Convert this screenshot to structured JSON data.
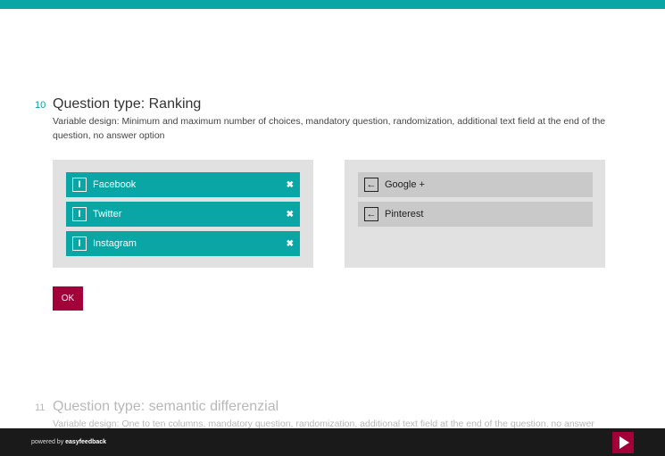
{
  "q10": {
    "number": "10",
    "title": "Question type: Ranking",
    "desc": "Variable design: Minimum and maximum number of choices, mandatory question, randomization, additional text field at the end of the question, no answer option",
    "selected": [
      {
        "label": "Facebook",
        "icon": "drag-handle-icon",
        "remove": "✖"
      },
      {
        "label": "Twitter",
        "icon": "drag-handle-icon",
        "remove": "✖"
      },
      {
        "label": "Instagram",
        "icon": "drag-handle-icon",
        "remove": "✖"
      }
    ],
    "available": [
      {
        "label": "Google +",
        "icon": "arrow-left-icon"
      },
      {
        "label": "Pinterest",
        "icon": "arrow-left-icon"
      }
    ],
    "ok_label": "OK"
  },
  "q11": {
    "number": "11",
    "title": "Question type: semantic differenzial",
    "desc": "Variable design: One to ten columns, mandatory question, randomization, additional text field at the end of the question, no answer"
  },
  "footer": {
    "powered_prefix": "powered by ",
    "powered_brand": "easyfeedback",
    "next_icon": "play-icon"
  },
  "colors": {
    "accent": "#0aa6a6",
    "button": "#a3003a",
    "panel": "#e1e1e1"
  }
}
